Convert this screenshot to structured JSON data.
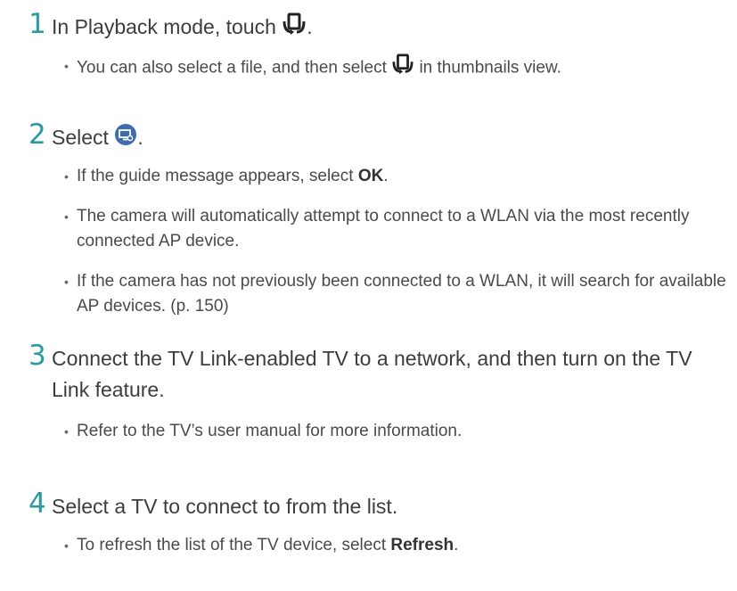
{
  "steps": [
    {
      "number": "1",
      "heading_before": "In Playback mode, touch",
      "heading_icon": "share-icon",
      "heading_after": ".",
      "bullets": [
        {
          "before": "You can also select a file, and then select",
          "icon": "share-icon",
          "after": "in thumbnails view."
        }
      ]
    },
    {
      "number": "2",
      "heading_before": "Select",
      "heading_icon": "tv-link-icon",
      "heading_after": ".",
      "bullets": [
        {
          "before": "If the guide message appears, select",
          "bold": "OK",
          "after": "."
        },
        {
          "text": "The camera will automatically attempt to connect to a WLAN via the most recently connected AP device."
        },
        {
          "text": "If the camera has not previously been connected to a WLAN, it will search for available AP devices. (p. 150)"
        }
      ]
    },
    {
      "number": "3",
      "heading": "Connect the TV Link-enabled TV to a network, and then turn on the TV Link feature.",
      "bullets": [
        {
          "text": "Refer to the TV’s user manual for more information."
        }
      ]
    },
    {
      "number": "4",
      "heading": "Select a TV to connect to from the list.",
      "bullets": [
        {
          "before": "To refresh the list of the TV device, select",
          "bold": "Refresh",
          "after": "."
        }
      ]
    }
  ],
  "bullet_glyph": "•",
  "colors": {
    "step_number": "#2a9a9f",
    "text": "#3d3d3d",
    "tv_icon": "#3f6bb0"
  }
}
